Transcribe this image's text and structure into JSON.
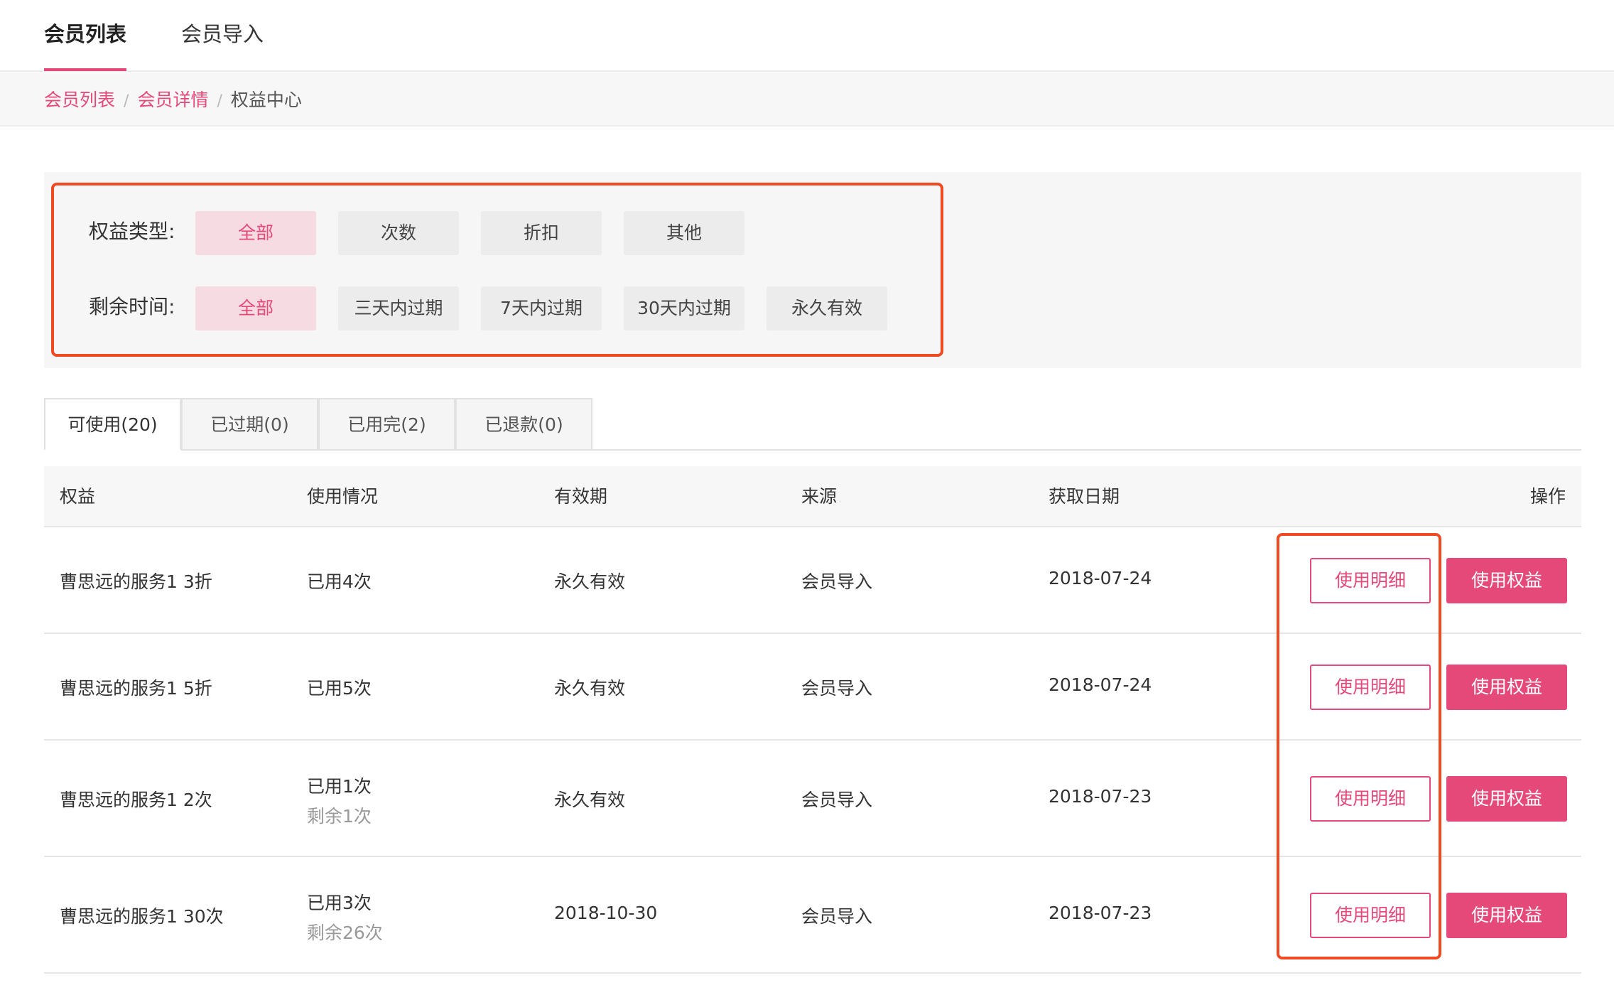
{
  "top_tabs": [
    {
      "label": "会员列表",
      "active": true
    },
    {
      "label": "会员导入",
      "active": false
    }
  ],
  "breadcrumb": {
    "items": [
      "会员列表",
      "会员详情",
      "权益中心"
    ],
    "separator": "/"
  },
  "filters": {
    "type_label": "权益类型:",
    "type_options": [
      "全部",
      "次数",
      "折扣",
      "其他"
    ],
    "type_selected": "全部",
    "time_label": "剩余时间:",
    "time_options": [
      "全部",
      "三天内过期",
      "7天内过期",
      "30天内过期",
      "永久有效"
    ],
    "time_selected": "全部"
  },
  "status_tabs": [
    "可使用(20)",
    "已过期(0)",
    "已用完(2)",
    "已退款(0)"
  ],
  "status_tab_active": "可使用(20)",
  "table": {
    "headers": [
      "权益",
      "使用情况",
      "有效期",
      "来源",
      "获取日期",
      "操作"
    ],
    "rows": [
      {
        "name": "曹思远的服务1 3折",
        "usage": "已用4次",
        "remaining": "",
        "validity": "永久有效",
        "source": "会员导入",
        "date": "2018-07-24",
        "detail_button": "使用明细",
        "use_button": "使用权益"
      },
      {
        "name": "曹思远的服务1 5折",
        "usage": "已用5次",
        "remaining": "",
        "validity": "永久有效",
        "source": "会员导入",
        "date": "2018-07-24",
        "detail_button": "使用明细",
        "use_button": "使用权益"
      },
      {
        "name": "曹思远的服务1 2次",
        "usage": "已用1次",
        "remaining": "剩余1次",
        "validity": "永久有效",
        "source": "会员导入",
        "date": "2018-07-23",
        "detail_button": "使用明细",
        "use_button": "使用权益"
      },
      {
        "name": "曹思远的服务1 30次",
        "usage": "已用3次",
        "remaining": "剩余26次",
        "validity": "2018-10-30",
        "source": "会员导入",
        "date": "2018-07-23",
        "detail_button": "使用明细",
        "use_button": "使用权益"
      }
    ]
  },
  "colors": {
    "accent": "#e5497a",
    "highlight_box": "#f04a23"
  }
}
